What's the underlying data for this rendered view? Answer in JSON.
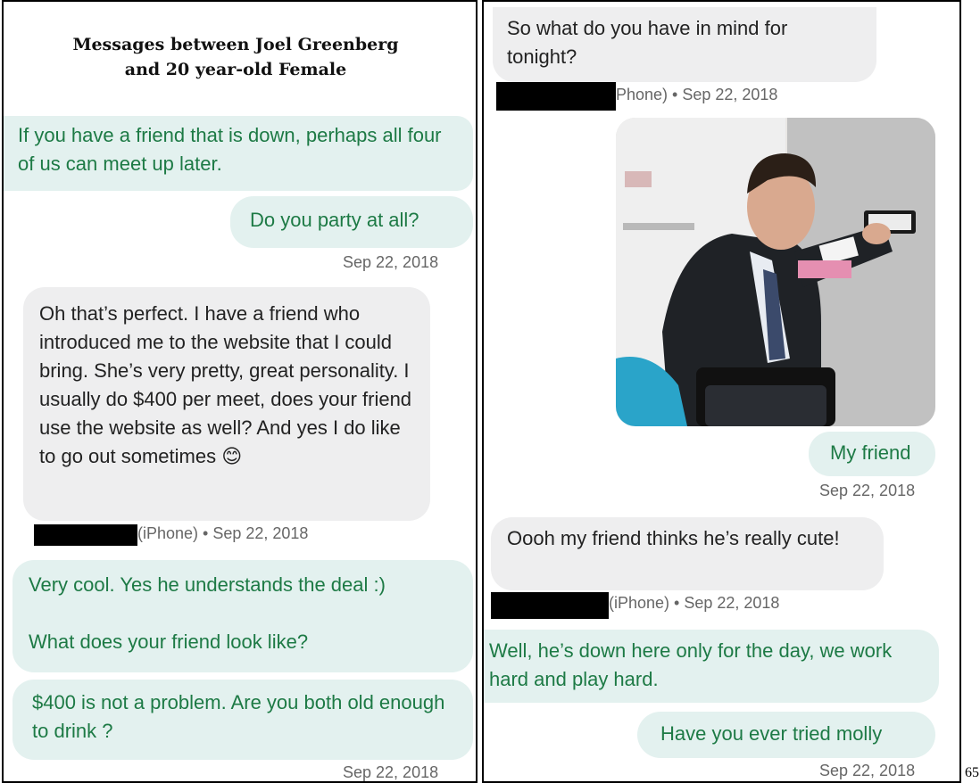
{
  "left": {
    "title": "Messages between Joel Greenberg\nand 20 year-old Female",
    "messages": [
      {
        "type": "sent",
        "text": "If you have a friend that is down, perhaps all four of us can meet up later."
      },
      {
        "type": "sent",
        "text": "Do you party at all?"
      },
      {
        "type": "recv",
        "text": "Oh that’s perfect. I have a friend who introduced me to the website that I could bring. She’s very pretty, great personality. I usually do $400 per meet, does your friend use the website as well? And yes I do like to go out sometimes 😊"
      },
      {
        "type": "sent",
        "text": "Very cool. Yes he understands the deal :)\n\nWhat does your friend look like?"
      },
      {
        "type": "sent",
        "text": "$400 is not a problem. Are you both old enough to drink ?"
      }
    ],
    "timestamps": [
      "Sep 22, 2018",
      "(iPhone) • Sep 22, 2018",
      "Sep 22, 2018"
    ]
  },
  "right": {
    "messages": [
      {
        "type": "recv",
        "text": "So what do you have in mind for tonight?"
      },
      {
        "type": "sent",
        "text": "My friend"
      },
      {
        "type": "recv",
        "text": "Oooh my friend thinks he’s really cute!"
      },
      {
        "type": "sent",
        "text": "Well, he’s down here only for the day, we work hard and play hard."
      },
      {
        "type": "sent",
        "text": "Have you ever tried molly"
      }
    ],
    "timestamps": [
      "Phone) • Sep 22, 2018",
      "Sep 22, 2018",
      "(iPhone) • Sep 22, 2018",
      "Sep 22, 2018"
    ]
  },
  "page_number": "65",
  "colors": {
    "sent_bubble": "#e3f1ef",
    "sent_text": "#1d7a45",
    "recv_bubble": "#eeeeef",
    "recv_text": "#222222",
    "timestamp": "#666666"
  }
}
